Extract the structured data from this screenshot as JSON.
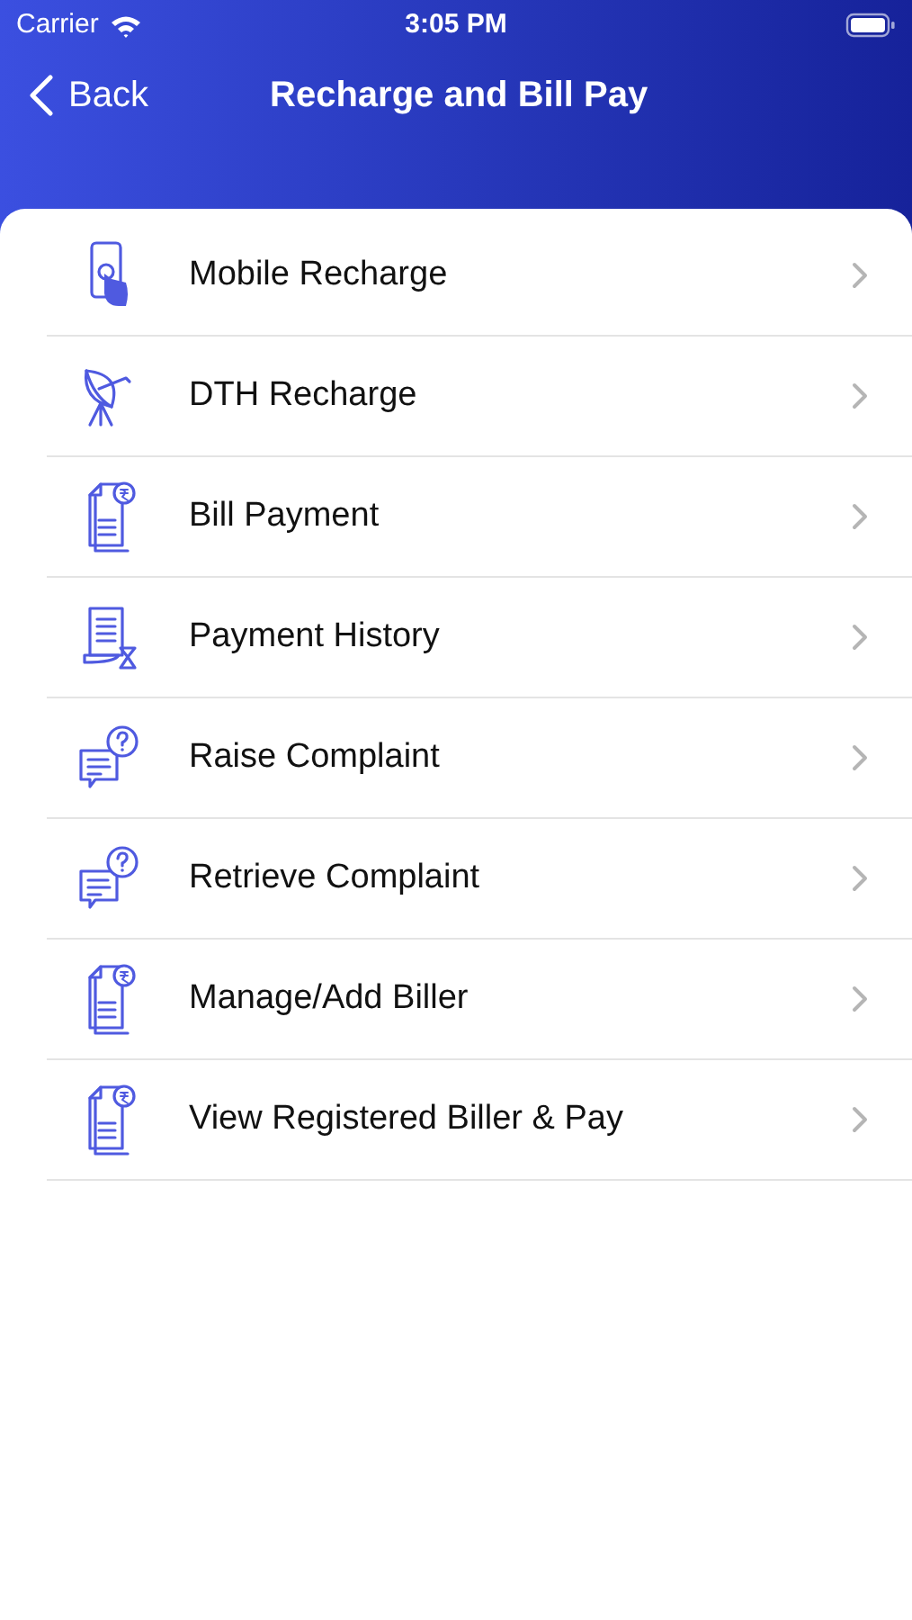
{
  "status_bar": {
    "carrier": "Carrier",
    "time": "3:05 PM"
  },
  "nav": {
    "back": "Back",
    "title": "Recharge and Bill Pay"
  },
  "items": [
    {
      "kind": "phone",
      "label": "Mobile Recharge"
    },
    {
      "kind": "dish",
      "label": "DTH Recharge"
    },
    {
      "kind": "bill",
      "label": "Bill Payment"
    },
    {
      "kind": "history",
      "label": "Payment History"
    },
    {
      "kind": "complaint",
      "label": "Raise Complaint"
    },
    {
      "kind": "complaint",
      "label": "Retrieve Complaint"
    },
    {
      "kind": "bill",
      "label": "Manage/Add Biller"
    },
    {
      "kind": "bill",
      "label": "View Registered Biller & Pay"
    }
  ]
}
